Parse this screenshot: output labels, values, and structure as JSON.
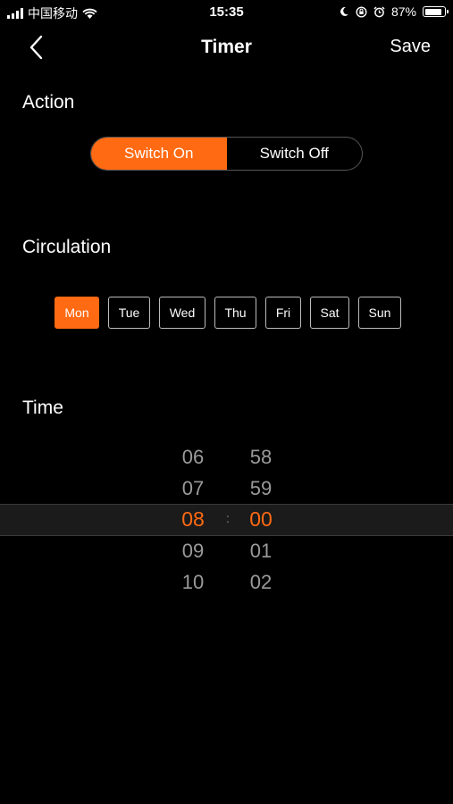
{
  "status": {
    "carrier": "中国移动",
    "time": "15:35",
    "battery": "87%",
    "battery_level": 0.87
  },
  "nav": {
    "title": "Timer",
    "save": "Save"
  },
  "action": {
    "label": "Action",
    "options": [
      "Switch On",
      "Switch Off"
    ],
    "selected": "Switch On"
  },
  "circulation": {
    "label": "Circulation",
    "days": [
      "Mon",
      "Tue",
      "Wed",
      "Thu",
      "Fri",
      "Sat",
      "Sun"
    ],
    "selected": [
      "Mon"
    ]
  },
  "time": {
    "label": "Time",
    "hours": [
      "06",
      "07",
      "08",
      "09",
      "10"
    ],
    "minutes": [
      "58",
      "59",
      "00",
      "01",
      "02"
    ],
    "separator": ":",
    "selected_hour": "08",
    "selected_minute": "00"
  },
  "colors": {
    "accent": "#ff6a13",
    "background": "#000000"
  }
}
